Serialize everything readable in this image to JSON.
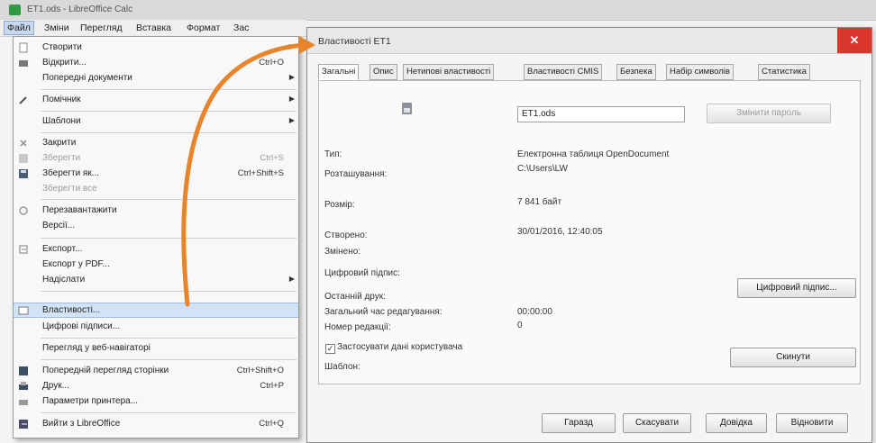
{
  "window": {
    "title": "ET1.ods - LibreOffice Calc"
  },
  "menubar": [
    "Файл",
    "Зміни",
    "Перегляд",
    "Вставка",
    "Формат",
    "Зас"
  ],
  "file_menu": {
    "items": [
      {
        "label": "Створити",
        "shortcut": "",
        "submenu": true,
        "disabled": false,
        "icon": "new-doc-icon"
      },
      {
        "label": "Відкрити...",
        "shortcut": "Ctrl+O",
        "submenu": false,
        "disabled": false,
        "icon": "open-folder-icon"
      },
      {
        "label": "Попередні документи",
        "shortcut": "",
        "submenu": true,
        "disabled": false,
        "icon": ""
      },
      {
        "label": "Помічник",
        "shortcut": "",
        "submenu": true,
        "disabled": false,
        "icon": "wizard-icon"
      },
      {
        "label": "Шаблони",
        "shortcut": "",
        "submenu": true,
        "disabled": false,
        "icon": ""
      },
      {
        "label": "Закрити",
        "shortcut": "",
        "submenu": false,
        "disabled": false,
        "icon": "close-doc-icon"
      },
      {
        "label": "Зберегти",
        "shortcut": "Ctrl+S",
        "submenu": false,
        "disabled": true,
        "icon": "save-icon"
      },
      {
        "label": "Зберегти як...",
        "shortcut": "Ctrl+Shift+S",
        "submenu": false,
        "disabled": false,
        "icon": "save-as-icon"
      },
      {
        "label": "Зберегти все",
        "shortcut": "",
        "submenu": false,
        "disabled": true,
        "icon": ""
      },
      {
        "label": "Перезавантажити",
        "shortcut": "",
        "submenu": false,
        "disabled": false,
        "icon": "reload-icon"
      },
      {
        "label": "Версії...",
        "shortcut": "",
        "submenu": false,
        "disabled": false,
        "icon": ""
      },
      {
        "label": "Експорт...",
        "shortcut": "",
        "submenu": false,
        "disabled": false,
        "icon": "export-icon"
      },
      {
        "label": "Експорт у PDF...",
        "shortcut": "",
        "submenu": false,
        "disabled": false,
        "icon": ""
      },
      {
        "label": "Надіслати",
        "shortcut": "",
        "submenu": true,
        "disabled": false,
        "icon": ""
      },
      {
        "label": "Властивості...",
        "shortcut": "",
        "submenu": false,
        "disabled": false,
        "icon": "properties-icon",
        "highlighted": true
      },
      {
        "label": "Цифрові підписи...",
        "shortcut": "",
        "submenu": false,
        "disabled": false,
        "icon": ""
      },
      {
        "label": "Перегляд у веб-навігаторі",
        "shortcut": "",
        "submenu": false,
        "disabled": false,
        "icon": ""
      },
      {
        "label": "Попередній перегляд сторінки",
        "shortcut": "Ctrl+Shift+O",
        "submenu": false,
        "disabled": false,
        "icon": "print-preview-icon"
      },
      {
        "label": "Друк...",
        "shortcut": "Ctrl+P",
        "submenu": false,
        "disabled": false,
        "icon": "print-icon"
      },
      {
        "label": "Параметри принтера...",
        "shortcut": "",
        "submenu": false,
        "disabled": false,
        "icon": "printer-settings-icon"
      },
      {
        "label": "Вийти з LibreOffice",
        "shortcut": "Ctrl+Q",
        "submenu": false,
        "disabled": false,
        "icon": "exit-icon"
      }
    ]
  },
  "dialog": {
    "title": "Властивості ET1",
    "tabs": [
      "Загальні",
      "Опис",
      "Нетипові властивості",
      "Властивості CMIS",
      "Безпека",
      "Набір символів",
      "Статистика"
    ],
    "filename": "ET1.ods",
    "change_password_btn": "Змінити пароль",
    "labels": {
      "type": "Тип:",
      "location": "Розташування:",
      "size": "Розмір:",
      "created": "Створено:",
      "modified": "Змінено:",
      "digital_signature": "Цифровий підпис:",
      "last_printed": "Останній друк:",
      "total_editing_time": "Загальний час редагування:",
      "revision_number": "Номер редакції:",
      "apply_user_data": "Застосувати дані користувача",
      "template": "Шаблон:"
    },
    "values": {
      "type": "Електронна таблиця OpenDocument",
      "location": "C:\\Users\\LW",
      "size": "7 841 байт",
      "created": "30/01/2016, 12:40:05",
      "total_editing_time": "00:00:00",
      "revision_number": "0"
    },
    "digital_signature_btn": "Цифровий підпис...",
    "reset_btn": "Скинути",
    "apply_user_data_checked": true,
    "footer": {
      "ok": "Гаразд",
      "cancel": "Скасувати",
      "help": "Довідка",
      "restore": "Відновити"
    }
  },
  "colors": {
    "arrow": "#e8842a",
    "close": "#d9352b",
    "highlight": "#d3e3f6"
  }
}
